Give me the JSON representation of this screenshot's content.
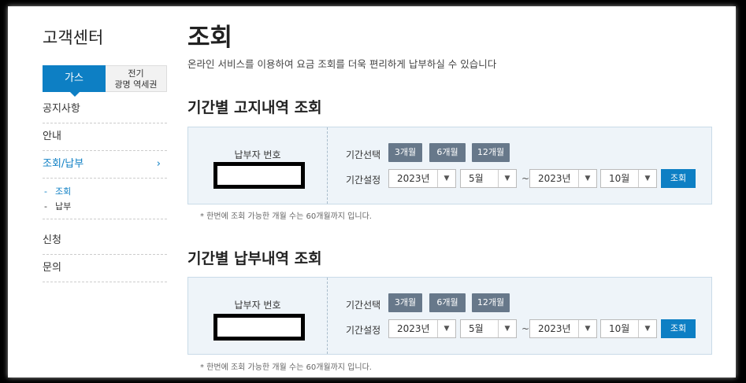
{
  "sidebar": {
    "title": "고객센터",
    "tabs": [
      {
        "label": "가스"
      },
      {
        "label_line1": "전기",
        "label_line2": "광명 역세권"
      }
    ],
    "menu": [
      {
        "label": "공지사항"
      },
      {
        "label": "안내"
      },
      {
        "label": "조회/납부",
        "chevron": "›"
      },
      {
        "label": "신청"
      },
      {
        "label": "문의"
      }
    ],
    "submenu": [
      {
        "label": "조회"
      },
      {
        "label": "납부"
      }
    ]
  },
  "main": {
    "title": "조회",
    "description": "온라인 서비스를 이용하여 요금 조회를 더욱 편리하게 납부하실 수 있습니다",
    "sections": [
      {
        "title": "기간별 고지내역 조회",
        "payer_label": "납부자 번호",
        "period_select_label": "기간선택",
        "period_buttons": [
          "3개월",
          "6개월",
          "12개월"
        ],
        "period_set_label": "기간설정",
        "from_year": "2023년",
        "from_month": "5월",
        "tilde": "~",
        "to_year": "2023년",
        "to_month": "10월",
        "search_label": "조회",
        "note": "* 한번에 조회 가능한 개월 수는 60개월까지 입니다."
      },
      {
        "title": "기간별 납부내역 조회",
        "payer_label": "납부자 번호",
        "period_select_label": "기간선택",
        "period_buttons": [
          "3개월",
          "6개월",
          "12개월"
        ],
        "period_set_label": "기간설정",
        "from_year": "2023년",
        "from_month": "5월",
        "tilde": "~",
        "to_year": "2023년",
        "to_month": "10월",
        "search_label": "조회",
        "note": "* 한번에 조회 가능한 개월 수는 60개월까지 입니다."
      }
    ]
  },
  "colors": {
    "accent": "#0d7fc4",
    "period_button": "#67788a",
    "box_bg": "#eef4f9"
  }
}
